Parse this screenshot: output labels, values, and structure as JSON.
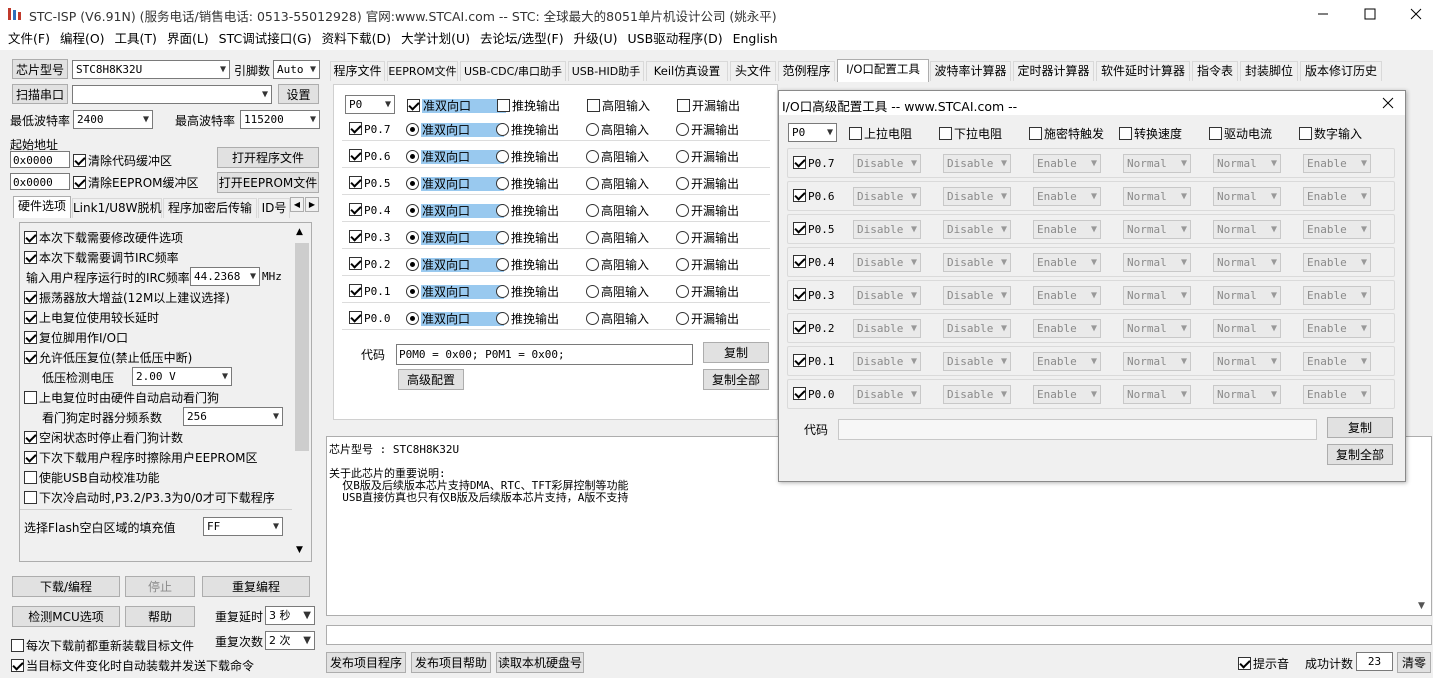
{
  "titlebar": {
    "title": "STC-ISP (V6.91N) (服务电话/销售电话: 0513-55012928) 官网:www.STCAI.com  -- STC: 全球最大的8051单片机设计公司 (姚永平)"
  },
  "menu": [
    "文件(F)",
    "编程(O)",
    "工具(T)",
    "界面(L)",
    "STC调试接口(G)",
    "资料下载(D)",
    "大学计划(U)",
    "去论坛/选型(F)",
    "升级(U)",
    "USB驱动程序(D)",
    "English"
  ],
  "left": {
    "chip_btn": "芯片型号",
    "chip_value": "STC8H8K32U",
    "pin_label": "引脚数",
    "pin_value": "Auto",
    "scan_btn": "扫描串口",
    "settings_btn": "设置",
    "min_baud_label": "最低波特率",
    "min_baud": "2400",
    "max_baud_label": "最高波特率",
    "max_baud": "115200",
    "start_addr_label": "起始地址",
    "addr1": "0x0000",
    "clear_code": "清除代码缓冲区",
    "open_prog": "打开程序文件",
    "addr2": "0x0000",
    "clear_eeprom": "清除EEPROM缓冲区",
    "open_eeprom": "打开EEPROM文件",
    "tabs": [
      "硬件选项",
      "Link1/U8W脱机",
      "程序加密后传输",
      "ID号"
    ],
    "options": [
      {
        "label": "本次下载需要修改硬件选项",
        "checked": true
      },
      {
        "label": "本次下载需要调节IRC频率",
        "checked": true
      }
    ],
    "irc_label": "输入用户程序运行时的IRC频率",
    "irc_value": "44.2368",
    "irc_unit": "MHz",
    "options2": [
      {
        "label": "振荡器放大增益(12M以上建议选择)",
        "checked": true
      },
      {
        "label": "上电复位使用较长延时",
        "checked": true
      },
      {
        "label": "复位脚用作I/O口",
        "checked": true
      },
      {
        "label": "允许低压复位(禁止低压中断)",
        "checked": true
      }
    ],
    "lvd_label": "低压检测电压",
    "lvd_value": "2.00 V",
    "wdt_label": "上电复位时由硬件自动启动看门狗",
    "wdt_div_label": "看门狗定时器分频系数",
    "wdt_div": "256",
    "options3": [
      {
        "label": "空闲状态时停止看门狗计数",
        "checked": true
      },
      {
        "label": "下次下载用户程序时擦除用户EEPROM区",
        "checked": true
      },
      {
        "label": "使能USB自动校准功能",
        "checked": false
      },
      {
        "label": "下次冷启动时,P3.2/P3.3为0/0才可下载程序",
        "checked": false
      }
    ],
    "fill_label": "选择Flash空白区域的填充值",
    "fill_value": "FF",
    "download_btn": "下载/编程",
    "stop_btn": "停止",
    "reprog_btn": "重复编程",
    "check_mcu_btn": "检测MCU选项",
    "help_btn": "帮助",
    "repeat_delay_label": "重复延时",
    "repeat_delay": "3 秒",
    "repeat_count_label": "重复次数",
    "repeat_count": "2 次",
    "reload_label": "每次下载前都重新装载目标文件",
    "auto_label": "当目标文件变化时自动装载并发送下载命令"
  },
  "main_tabs": [
    "程序文件",
    "EEPROM文件",
    "USB-CDC/串口助手",
    "USB-HID助手",
    "Keil仿真设置",
    "头文件",
    "范例程序",
    "I/O口配置工具",
    "波特率计算器",
    "定时器计算器",
    "软件延时计算器",
    "指令表",
    "封装脚位",
    "版本修订历史"
  ],
  "io": {
    "port": "P0",
    "modes": [
      "准双向口",
      "推挽输出",
      "高阻输入",
      "开漏输出"
    ],
    "pins": [
      "P0.7",
      "P0.6",
      "P0.5",
      "P0.4",
      "P0.3",
      "P0.2",
      "P0.1",
      "P0.0"
    ],
    "code_label": "代码",
    "code_value": "P0M0 = 0x00; P0M1 = 0x00;",
    "copy_btn": "复制",
    "advanced_btn": "高级配置",
    "copy_all_btn": "复制全部"
  },
  "info": {
    "chip_line": "芯片型号 : STC8H8K32U",
    "heading": "关于此芯片的重要说明:",
    "line1": "  仅B版及后续版本芯片支持DMA、RTC、TFT彩屏控制等功能",
    "line2": "  USB直接仿真也只有仅B版及后续版本芯片支持，A版不支持"
  },
  "bottom": {
    "btn1": "发布项目程序",
    "btn2": "发布项目帮助",
    "btn3": "读取本机硬盘号",
    "hint_label": "提示音",
    "count_label": "成功计数",
    "count_value": "23",
    "clear_btn": "清零"
  },
  "adv": {
    "title": "I/O口高级配置工具 -- www.STCAI.com --",
    "port": "P0",
    "headers": [
      "上拉电阻",
      "下拉电阻",
      "施密特触发",
      "转换速度",
      "驱动电流",
      "数字输入"
    ],
    "pins": [
      "P0.7",
      "P0.6",
      "P0.5",
      "P0.4",
      "P0.3",
      "P0.2",
      "P0.1",
      "P0.0"
    ],
    "values": [
      "Disable",
      "Disable",
      "Enable",
      "Normal",
      "Normal",
      "Enable"
    ],
    "code_label": "代码",
    "copy_btn": "复制",
    "copy_all_btn": "复制全部"
  },
  "colors": {
    "accent": "#99c9ef",
    "title_bar": "#ffffff",
    "background": "#f0f0f0"
  }
}
